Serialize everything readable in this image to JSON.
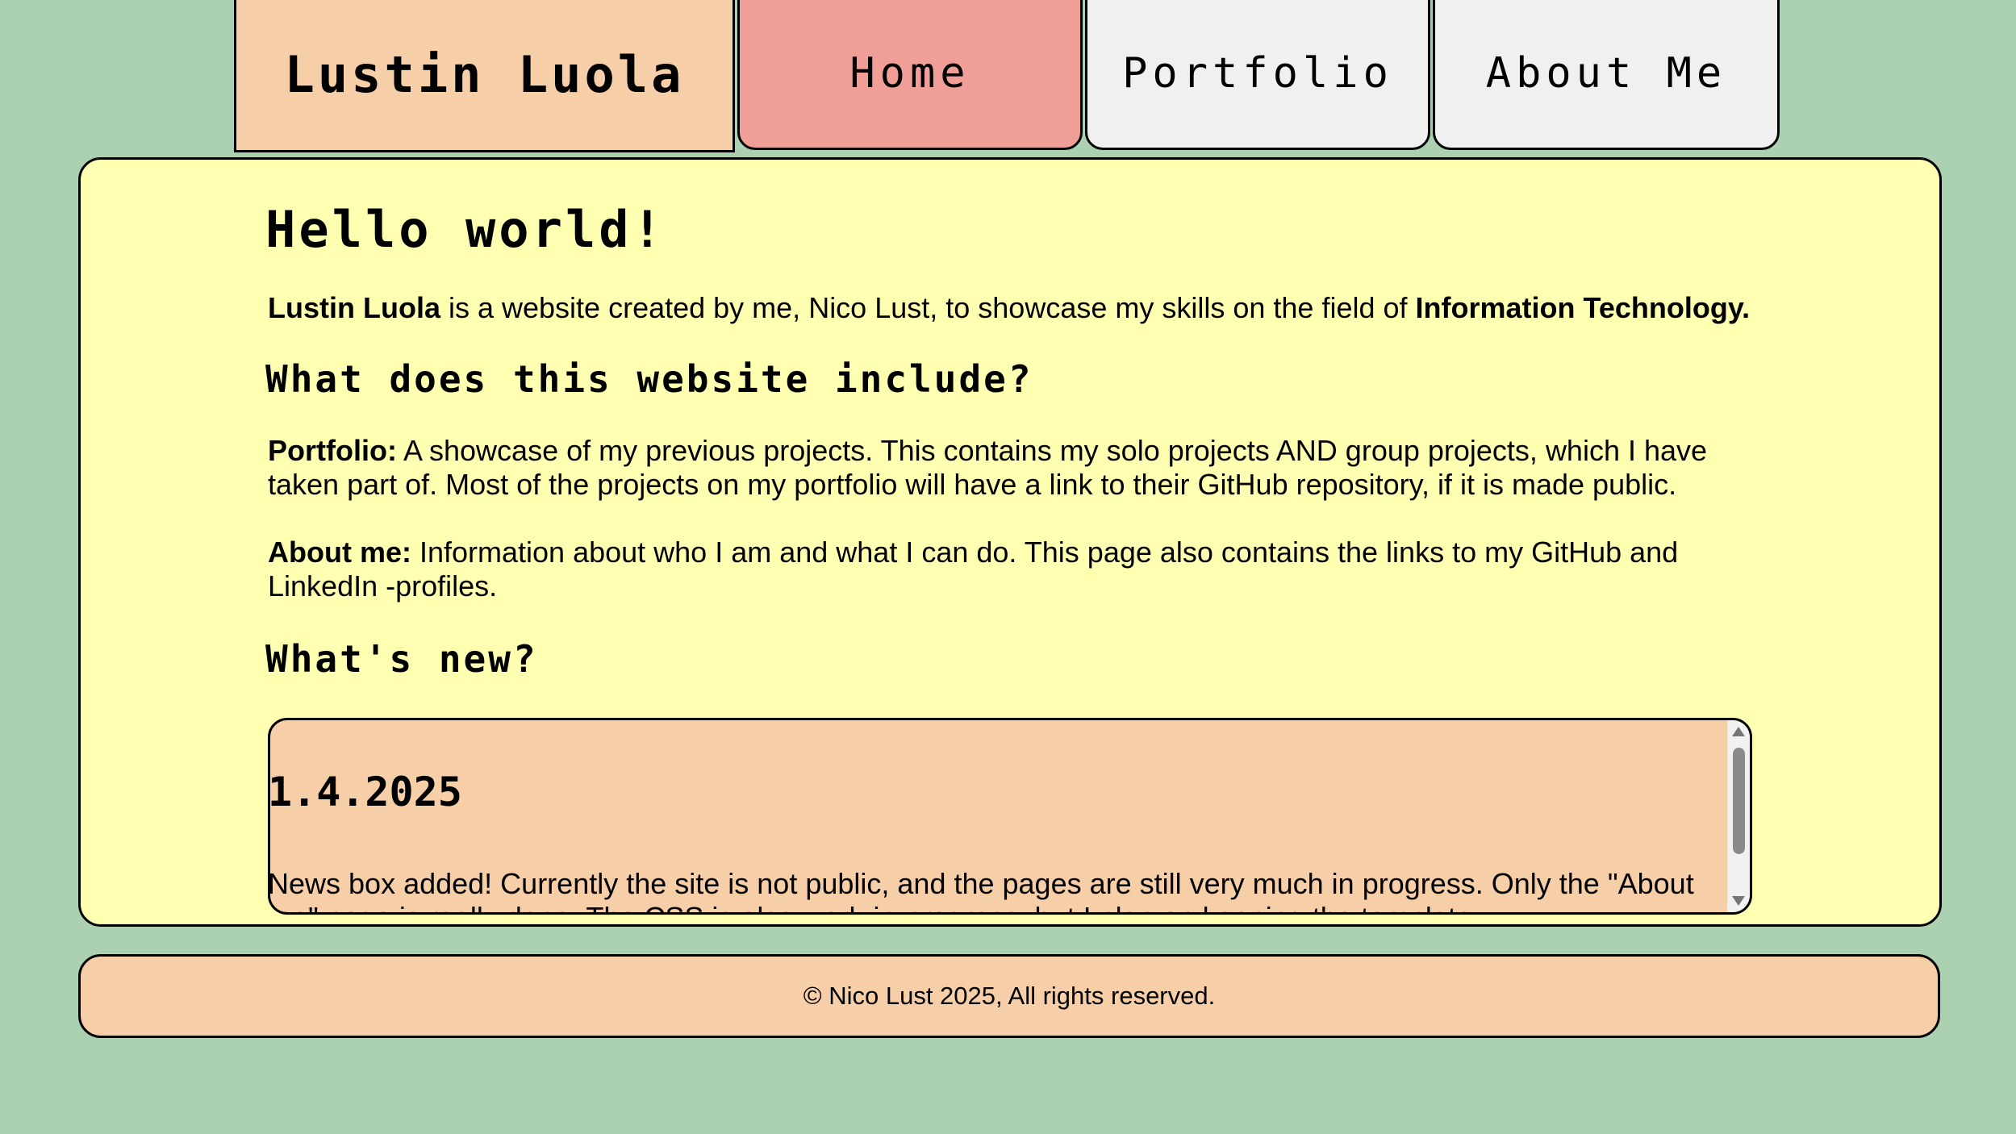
{
  "nav": {
    "brand": "Lustin Luola",
    "tabs": [
      {
        "label": "Home",
        "active": true
      },
      {
        "label": "Portfolio",
        "active": false
      },
      {
        "label": "About Me",
        "active": false
      }
    ]
  },
  "main": {
    "title": "Hello world!",
    "intro": {
      "brand_bold": "Lustin Luola",
      "text": " is a website created by me, Nico Lust, to showcase my skills on the field of ",
      "field_bold": "Information Technology."
    },
    "include_heading": "What does this website include?",
    "portfolio": {
      "label": "Portfolio:",
      "text": " A showcase of my previous projects. This contains my solo projects AND group projects, which I have taken part of. Most of the projects on my portfolio will have a link to their GitHub repository, if it is made public."
    },
    "about": {
      "label": "About me:",
      "text": " Information about who I am and what I can do. This page also contains the links to my GitHub and LinkedIn -profiles."
    },
    "news_heading": "What's new?",
    "news": {
      "date": "1.4.2025",
      "text": "News box added! Currently the site is not public, and the pages are still very much in progress. Only the \"About me\" page is really done. The CSS is also work-in-progress, but I plan on keeping the template."
    }
  },
  "footer": {
    "text": "© Nico Lust 2025, All rights reserved."
  },
  "colors": {
    "background": "#abd1b0",
    "panel": "#ffffb1",
    "accent": "#f6cea7",
    "active_tab": "#ef9f97",
    "inactive_tab": "#f0f0f0"
  }
}
